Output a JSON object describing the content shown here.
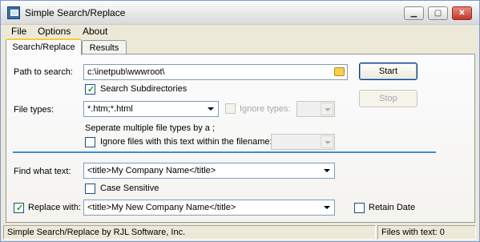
{
  "window": {
    "title": "Simple Search/Replace",
    "controls": {
      "minimize": "▁",
      "maximize": "▢",
      "close": "✕"
    }
  },
  "menu": [
    "File",
    "Options",
    "About"
  ],
  "tabs": [
    {
      "label": "Search/Replace",
      "active": true
    },
    {
      "label": "Results",
      "active": false
    }
  ],
  "form": {
    "path_label": "Path to search:",
    "path_value": "c:\\inetpub\\wwwroot\\",
    "search_subdirs_label": "Search Subdirectories",
    "search_subdirs_checked": true,
    "file_types_label": "File types:",
    "file_types_value": "*.htm;*.html",
    "ignore_types_label": "Ignore types:",
    "ignore_types_value": "",
    "separate_hint": "Seperate multiple file types by a ;",
    "ignore_files_label": "Ignore files with this text within the filename:",
    "ignore_files_value": "",
    "find_label": "Find what text:",
    "find_value": "<title>My Company Name</title>",
    "case_sensitive_label": "Case Sensitive",
    "replace_label": "Replace with:",
    "replace_checked": true,
    "replace_value": "<title>My New Company Name</title>",
    "retain_date_label": "Retain Date"
  },
  "buttons": {
    "start": "Start",
    "stop": "Stop"
  },
  "status": {
    "left": "Simple Search/Replace by RJL Software, Inc.",
    "right": "Files with text: 0"
  },
  "colors": {
    "accent_line": "#3c8ed9",
    "tab_highlight": "#ffc83c",
    "check": "#21a121"
  }
}
